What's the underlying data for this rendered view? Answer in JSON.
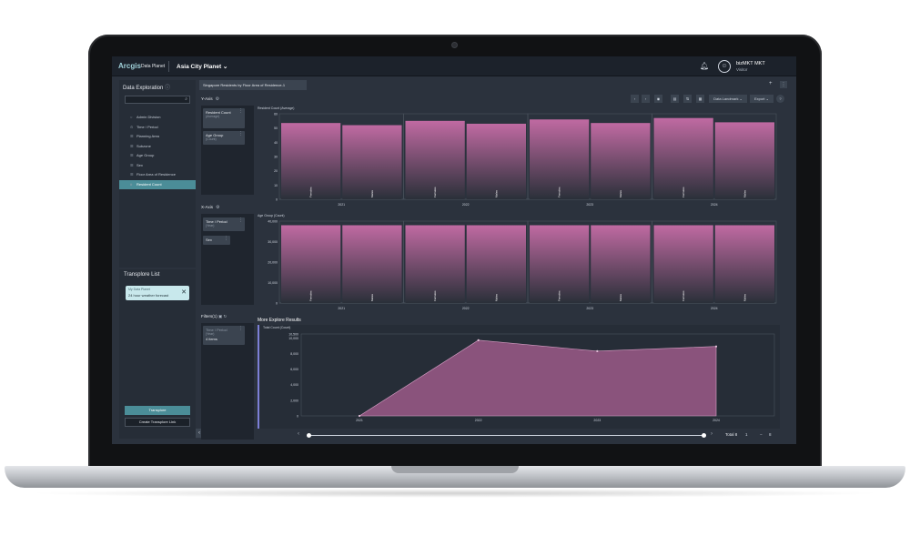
{
  "app": {
    "logo": "Arcgis",
    "logo_sub": "Data Planet",
    "project": "Asia City Planet ⌄",
    "user_name": "bizMKT MKT",
    "user_role": "Visitor"
  },
  "sidebar": {
    "title": "Data Exploration",
    "search_placeholder": "",
    "items": [
      {
        "label": "Admin Division",
        "icon": "○"
      },
      {
        "label": "Time / Period",
        "icon": "⊙"
      },
      {
        "label": "Planning Area",
        "icon": "☰"
      },
      {
        "label": "Subzone",
        "icon": "☰"
      },
      {
        "label": "Age Group",
        "icon": "☰"
      },
      {
        "label": "Sex",
        "icon": "☰"
      },
      {
        "label": "Floor Area of Residence",
        "icon": "☰"
      },
      {
        "label": "Resident Count",
        "icon": "#"
      }
    ]
  },
  "transplore": {
    "title": "Transplore List",
    "card_sub": "My Data Planet",
    "card_main": "24 hour weather forecast",
    "btn_transplore": "Transplore",
    "btn_create": "Create Transplore Link"
  },
  "tabs": {
    "active": "Singapore Residents by Floor Area of Residence-1",
    "add": "+",
    "more": "⋮"
  },
  "axes": {
    "y_label": "Y-Axis",
    "x_label": "X-Axis",
    "filters_label": "Filters(1)",
    "y_chip1": "Resident Count",
    "y_chip1_sub": "(Average)",
    "y_chip2": "Age Group",
    "y_chip2_sub": "(Count)",
    "x_chip1": "Time / Period",
    "x_chip1_sub": "(Year)",
    "x_chip2": "Sex",
    "filter_chip": "Time / Period",
    "filter_chip_sub": "(Year)",
    "filter_chip_value": "4 items"
  },
  "toolbar": {
    "data_landmark": "Data Landmark ⌄",
    "export": "Export ⌄",
    "help": "?"
  },
  "more_results": "More Explore Results",
  "pagination": {
    "total": "Total 8",
    "page": "1",
    "page_size": "8"
  },
  "colors": {
    "bar_top": "#c06aa2",
    "bar_bottom": "#2a3039",
    "area": "#9c5a88"
  },
  "chart_data": [
    {
      "type": "bar",
      "ylabel": "Resident Count (Average)",
      "ylim": [
        0,
        60
      ],
      "yticks": [
        "0",
        "10",
        "20",
        "30",
        "40",
        "50",
        "60"
      ],
      "groups": [
        "2021",
        "2022",
        "2023",
        "2024"
      ],
      "categories": [
        "Females",
        "Males"
      ],
      "series": [
        {
          "name": "Females",
          "values": [
            53.5,
            55,
            56,
            57
          ]
        },
        {
          "name": "Males",
          "values": [
            52,
            53,
            53.5,
            54
          ]
        }
      ]
    },
    {
      "type": "bar",
      "ylabel": "Age Group (Count)",
      "ylim": [
        0,
        40000
      ],
      "yticks": [
        "0",
        "10,000",
        "20,000",
        "30,000",
        "40,000"
      ],
      "groups": [
        "2021",
        "2022",
        "2023",
        "2024"
      ],
      "categories": [
        "Females",
        "Males"
      ],
      "series": [
        {
          "name": "Females",
          "values": [
            38000,
            38000,
            38000,
            38000
          ]
        },
        {
          "name": "Males",
          "values": [
            38000,
            38000,
            38000,
            38000
          ]
        }
      ]
    },
    {
      "type": "area",
      "ylabel": "Total Count (Count)",
      "ylim": [
        0,
        10500
      ],
      "yticks": [
        "0",
        "2,000",
        "4,000",
        "6,000",
        "8,000",
        "10,000",
        "10,500"
      ],
      "x": [
        "2021",
        "2022",
        "2023",
        "2024"
      ],
      "values": [
        0,
        9700,
        8300,
        8900
      ]
    }
  ]
}
